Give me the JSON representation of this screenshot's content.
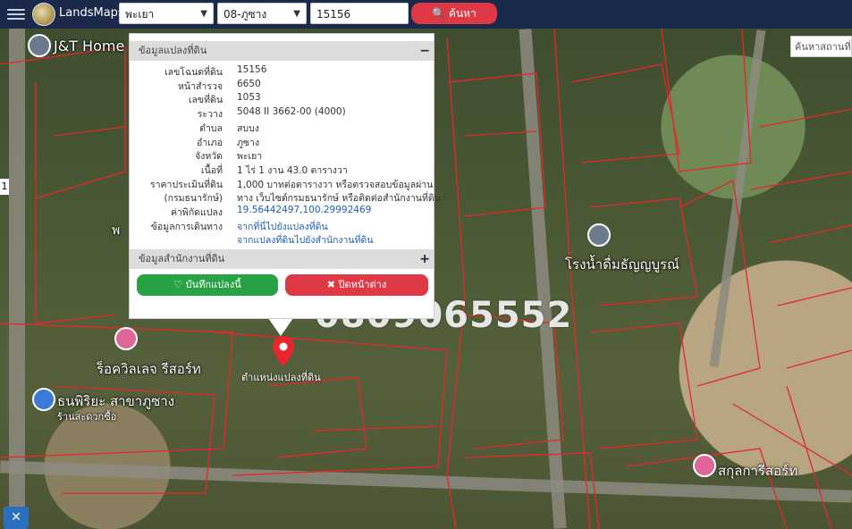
{
  "topbar": {
    "brand": "LandsMaps",
    "province": "พะเยา",
    "district": "08-ภูซาง",
    "deed_number": "15156",
    "search_label": "ค้นหา"
  },
  "side_search": {
    "placeholder": "ค้นหาสถานที่ส"
  },
  "popup": {
    "section_parcel": "ข้อมูลแปลงที่ดิน",
    "section_toggle_open": "−",
    "rows": [
      {
        "label": "เลขโฉนดที่ดิน",
        "value": "15156"
      },
      {
        "label": "หน้าสำรวจ",
        "value": "6650"
      },
      {
        "label": "เลขที่ดิน",
        "value": "1053"
      },
      {
        "label": "ระวาง",
        "value": "5048 II 3662-00 (4000)"
      },
      {
        "label": "ตำบล",
        "value": "สบบง"
      },
      {
        "label": "อำเภอ",
        "value": "ภูซาง"
      },
      {
        "label": "จังหวัด",
        "value": "พะเยา"
      },
      {
        "label": "เนื้อที่",
        "value": "1 ไร่ 1 งาน 43.0 ตารางวา"
      },
      {
        "label": "ราคาประเมินที่ดิน",
        "value": "1,000 บาทต่อตารางวา หรือตรวจสอบข้อมูลผ่าน"
      },
      {
        "label": "(กรมธนารักษ์)",
        "value": "ทาง เว็บไซต์กรมธนารักษ์ หรือติดต่อสำนักงานที่ดิน"
      },
      {
        "label": "ค่าพิกัดแปลง",
        "value": "19.56442497,100.29992469"
      },
      {
        "label": "ข้อมูลการเดินทาง",
        "value": "จากที่นี่ไปยังแปลงที่ดิน"
      },
      {
        "label": "",
        "value": "จากแปลงที่ดินไปยังสำนักงานที่ดิน"
      }
    ],
    "section_office": "ข้อมูลสำนักงานที่ดิน",
    "section_toggle_closed": "+",
    "save_label": "บันทึกแปลงนี้",
    "close_label": "ปิดหน้าต่าง"
  },
  "map": {
    "overlay_phone": "0809065552",
    "marker_label": "ตำแหน่งแปลงที่ดิน",
    "places": [
      {
        "name": "J&T Home"
      },
      {
        "name": "โรงน้ำดื่มธัญญบูรณ์"
      },
      {
        "name": "ร็อควิลเลจ รีสอร์ท"
      },
      {
        "name": "ธนพิริยะ สาขาภูซาง"
      },
      {
        "name": "ร้านสะดวกซื้อ"
      },
      {
        "name": "สกุลการีสอร์ท"
      }
    ],
    "edge_label": "1",
    "road_label": "พ"
  },
  "colors": {
    "topbar": "#1b2a4a",
    "search_button": "#e03946",
    "save_button": "#27a244",
    "close_button": "#e03946",
    "parcel_lines": "#e8262b",
    "link": "#1d5fb8"
  }
}
